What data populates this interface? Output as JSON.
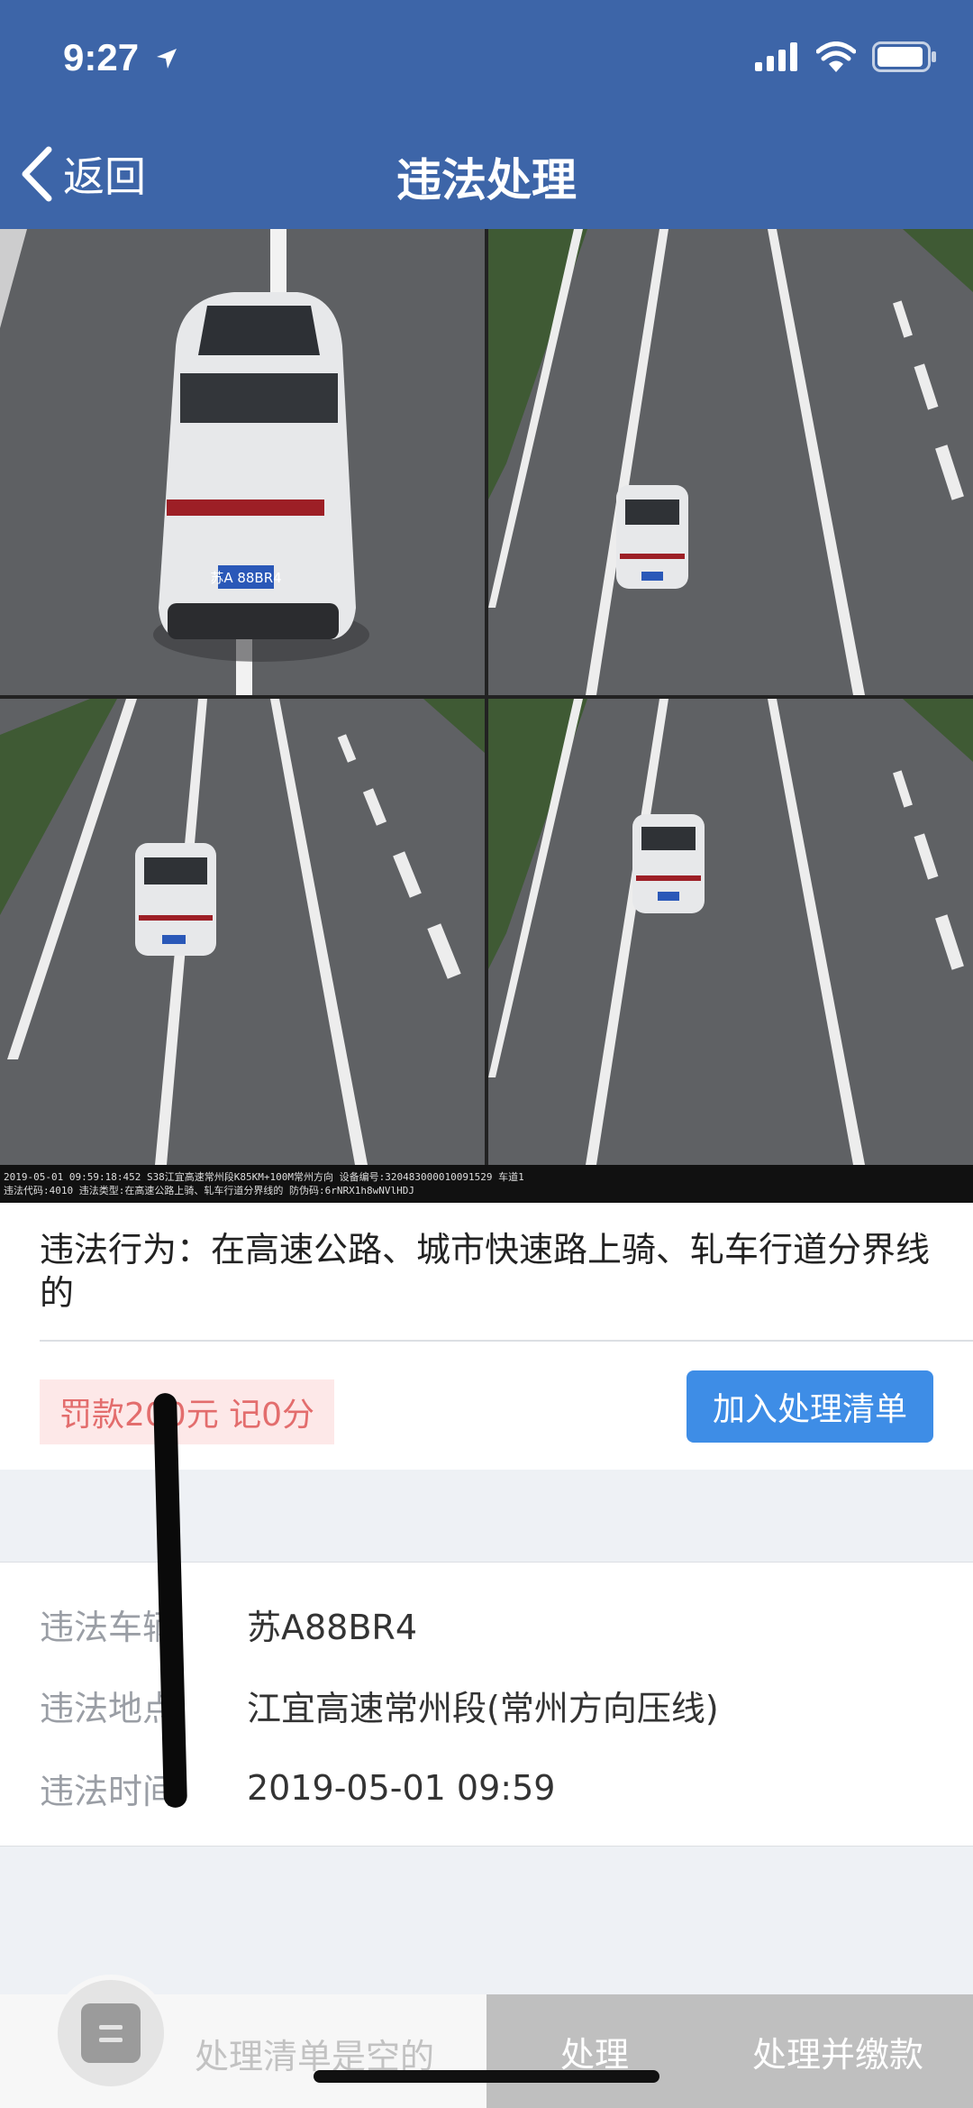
{
  "status_bar": {
    "time": "9:27"
  },
  "nav": {
    "back_label": "返回",
    "title": "违法处理"
  },
  "photos": {
    "caption_line1": "2019-05-01 09:59:18:452  S38江宜高速常州段K85KM+100M常州方向  设备编号:320483000010091529  车道1",
    "caption_line2": "违法代码:4010  违法类型:在高速公路上骑、轧车行道分界线的  防伪码:6rNRX1h8wNVlHDJ",
    "plate": "苏A 88BR4"
  },
  "violation": {
    "description": "违法行为：在高速公路、城市快速路上骑、轧车行道分界线的",
    "fine": "罚款200元  记0分",
    "add_button": "加入处理清单"
  },
  "details": {
    "rows": [
      {
        "label": "违法车辆",
        "value": "苏A88BR4"
      },
      {
        "label": "违法地点",
        "value": "江宜高速常州段(常州方向压线)"
      },
      {
        "label": "违法时间",
        "value": "2019-05-01 09:59"
      }
    ]
  },
  "bottom_bar": {
    "empty_text": "处理清单是空的",
    "process_button": "处理",
    "pay_button": "处理并缴款"
  },
  "colors": {
    "nav": "#3d65a8",
    "button": "#3e8de6",
    "fine_text": "#e36d6d",
    "disabled": "#bfbfbf"
  }
}
